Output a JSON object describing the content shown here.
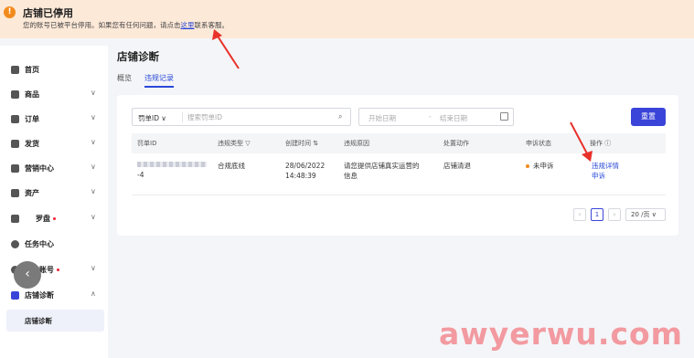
{
  "banner": {
    "icon": "warning-icon",
    "title": "店铺已停用",
    "message_prefix": "您的账号已被平台停用。如果您有任何问题，请点击",
    "link": "这里",
    "message_suffix": "联系客服。"
  },
  "sidebar": {
    "items": [
      {
        "label": "首页",
        "icon": "home-icon"
      },
      {
        "label": "商品",
        "icon": "product-icon"
      },
      {
        "label": "订单",
        "icon": "order-icon"
      },
      {
        "label": "发货",
        "icon": "shipping-icon"
      },
      {
        "label": "营销中心",
        "icon": "marketing-icon"
      },
      {
        "label": "资产",
        "icon": "wallet-icon"
      },
      {
        "label": "罗盘",
        "icon": "compass-icon"
      },
      {
        "label": "任务中心",
        "icon": "task-icon"
      },
      {
        "label": "我的账号",
        "icon": "user-icon"
      },
      {
        "label": "店铺诊断",
        "icon": "diagnosis-icon"
      }
    ],
    "sub_item": "店铺诊断",
    "collapse_glyph": "‹"
  },
  "main": {
    "title": "店铺诊断",
    "tabs": [
      "概览",
      "违规记录"
    ],
    "active_tab": "违规记录"
  },
  "filters": {
    "type_select": "罚单ID",
    "search_placeholder": "搜索罚单ID",
    "start_date": "开始日期",
    "date_sep": "-",
    "end_date": "结束日期",
    "reset": "重置"
  },
  "table": {
    "headers": [
      "罚单ID",
      "违规类型",
      "创建时间",
      "违规原因",
      "处置动作",
      "申诉状态",
      "操作"
    ],
    "row": {
      "id_suffix": "-4",
      "type": "合规底线",
      "time_date": "28/06/2022",
      "time_clock": "14:48:39",
      "reason_line1": "请您提供店铺真实运营的",
      "reason_line2": "信息",
      "action": "店铺清退",
      "status": "未申诉",
      "op_detail": "违规详情",
      "op_appeal": "申诉"
    }
  },
  "pagination": {
    "prev": "‹",
    "current": "1",
    "next": "›",
    "page_size": "20 /页"
  },
  "watermark": "awyerwu.com",
  "colors": {
    "banner_bg": "#fde9d8",
    "warning": "#f28b1c",
    "primary": "#3a44d8",
    "link": "#2a49d8",
    "annotation_arrow": "#e8312a"
  }
}
